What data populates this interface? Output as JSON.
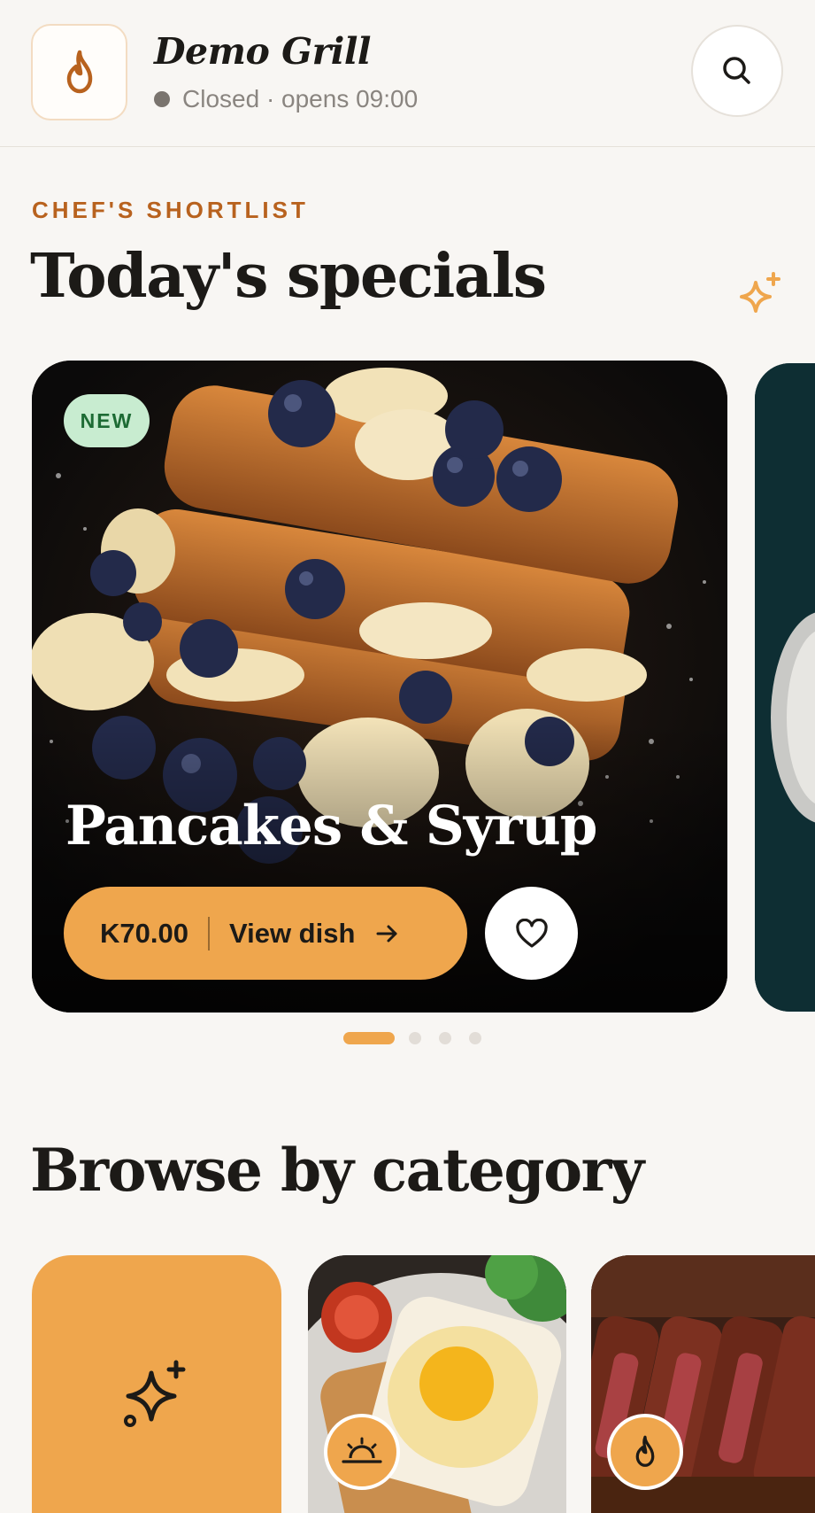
{
  "header": {
    "restaurant_name": "Demo Grill",
    "status_text": "Closed · opens 09:00",
    "logo_icon": "flame-icon",
    "search_icon": "search-icon"
  },
  "specials": {
    "eyebrow": "CHEF'S SHORTLIST",
    "title": "Today's specials",
    "cards": [
      {
        "badge": "NEW",
        "name": "Pancakes & Syrup",
        "price": "K70.00",
        "cta_label": "View dish"
      }
    ],
    "carousel": {
      "total": 4,
      "active_index": 0
    }
  },
  "categories": {
    "title": "Browse by category",
    "tiles": [
      {
        "icon": "sparkle-icon"
      },
      {
        "icon": "sunrise-icon"
      },
      {
        "icon": "flame-icon"
      }
    ]
  },
  "colors": {
    "accent": "#efa64d",
    "eyebrow": "#b8621e",
    "background": "#f8f6f3",
    "badge_bg": "#c8ecd0",
    "badge_text": "#1d6b34"
  }
}
